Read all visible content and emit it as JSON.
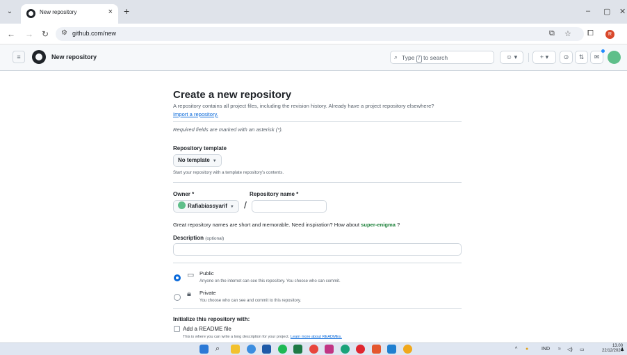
{
  "browser": {
    "tab_title": "New repository",
    "tab_close": "×",
    "new_tab": "+",
    "tab_menu": "⌄",
    "url": "github.com/new",
    "window_controls": [
      "–",
      "▢",
      "✕"
    ]
  },
  "header": {
    "context": "New repository",
    "search_prefix": "Type",
    "search_key": "/",
    "search_suffix": "to search",
    "create_button": "+ ▾",
    "copilot_button": "☺ ▾"
  },
  "main": {
    "title": "Create a new repository",
    "intro": "A repository contains all project files, including the revision history. Already have a project repository elsewhere?",
    "import_link": "Import a repository.",
    "required_note": "Required fields are marked with an asterisk (*).",
    "template": {
      "label": "Repository template",
      "value": "No template",
      "hint": "Start your repository with a template repository's contents."
    },
    "owner": {
      "label": "Owner *",
      "value": "Rafiabiassyarif"
    },
    "repo_name": {
      "label": "Repository name *",
      "value": "",
      "slash": "/"
    },
    "inspiration": {
      "text": "Great repository names are short and memorable. Need inspiration? How about",
      "suggestion": "super-enigma",
      "end": "?"
    },
    "description": {
      "label": "Description",
      "optional": "(optional)",
      "value": ""
    },
    "visibility": [
      {
        "title": "Public",
        "desc": "Anyone on the internet can see this repository. You choose who can commit.",
        "checked": true
      },
      {
        "title": "Private",
        "desc": "You choose who can see and commit to this repository.",
        "checked": false
      }
    ],
    "initialize": {
      "label": "Initialize this repository with:",
      "readme_label": "Add a README file",
      "readme_desc": "This is where you can write a long description for your project.",
      "readme_link": "Learn more about READMEs."
    }
  },
  "taskbar": {
    "apps": [
      "windows-start",
      "search",
      "file-explorer",
      "chat",
      "store",
      "spotify",
      "excel",
      "chrome",
      "instagram",
      "edge",
      "opera",
      "office",
      "vscode",
      "chrome-2"
    ],
    "tray_lang": "IND",
    "time": "13.00",
    "date": "22/12/2024"
  },
  "colors": {
    "accent": "#0969da",
    "suggestion": "#1a7f37",
    "tab_strip": "#dfe3ea"
  }
}
